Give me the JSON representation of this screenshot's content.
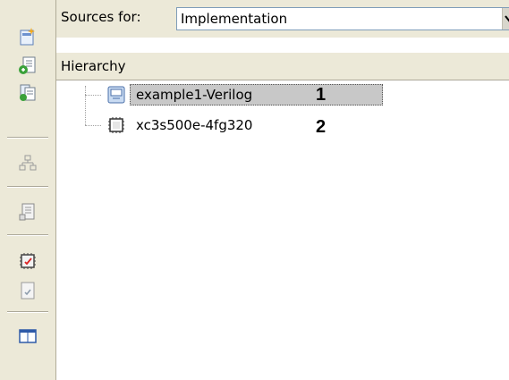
{
  "toolbar": {
    "buttons": [
      {
        "icon": "new-source-icon"
      },
      {
        "icon": "add-source-icon"
      },
      {
        "icon": "add-copy-source-icon"
      },
      {
        "icon": "group-icon"
      },
      {
        "icon": "open-document-icon"
      },
      {
        "icon": "chip-icon"
      },
      {
        "icon": "edit-document-icon"
      },
      {
        "icon": "window-layout-icon"
      }
    ]
  },
  "sources": {
    "label": "Sources for:",
    "value": "Implementation"
  },
  "hierarchy": {
    "title": "Hierarchy",
    "nodes": [
      {
        "label": "example1-Verilog",
        "marker": "1",
        "selected": true,
        "icon": "project-icon"
      },
      {
        "label": "xc3s500e-4fg320",
        "marker": "2",
        "selected": false,
        "icon": "fpga-device-icon"
      }
    ]
  },
  "colors": {
    "toolbar_bg": "#ece9d8",
    "selection_bg": "#c8c8c8",
    "select_border": "#7f9db9"
  }
}
